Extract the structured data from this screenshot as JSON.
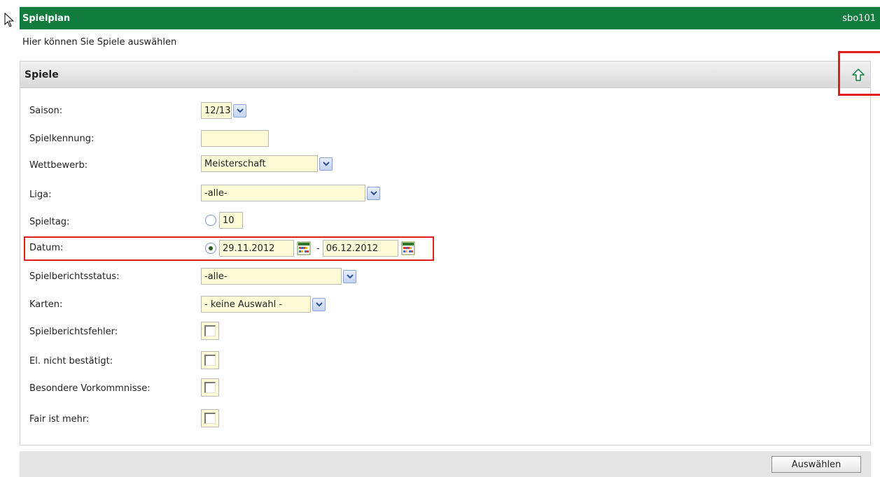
{
  "header": {
    "title": "Spielplan",
    "user": "sbo101"
  },
  "intro": "Hier können Sie Spiele auswählen",
  "panel": {
    "title": "Spiele",
    "up_icon": "arrow-up-icon"
  },
  "form": {
    "saison": {
      "label": "Saison:",
      "value": "12/13"
    },
    "spielkennung": {
      "label": "Spielkennung:",
      "value": ""
    },
    "wettbewerb": {
      "label": "Wettbewerb:",
      "value": "Meisterschaft"
    },
    "liga": {
      "label": "Liga:",
      "value": "-alle-"
    },
    "spieltag": {
      "label": "Spieltag:",
      "value": "10",
      "selected": false
    },
    "datum": {
      "label": "Datum:",
      "from": "29.11.2012",
      "separator": "-",
      "to": "06.12.2012",
      "selected": true
    },
    "spielberichtsstatus": {
      "label": "Spielberichtsstatus:",
      "value": "-alle-"
    },
    "karten": {
      "label": "Karten:",
      "value": "- keine Auswahl -"
    },
    "spielberichtsfehler": {
      "label": "Spielberichtsfehler:",
      "checked": false
    },
    "el_nicht_bestaetigt": {
      "label": "El. nicht bestätigt:",
      "checked": false
    },
    "besondere_vorkommnisse": {
      "label": "Besondere Vorkommnisse:",
      "checked": false
    },
    "fair_ist_mehr": {
      "label": "Fair ist mehr:",
      "checked": false
    }
  },
  "footer": {
    "submit_label": "Auswählen"
  },
  "colors": {
    "header_bg": "#127c3f",
    "input_bg": "#fffbd7",
    "highlight": "#e31b23"
  }
}
